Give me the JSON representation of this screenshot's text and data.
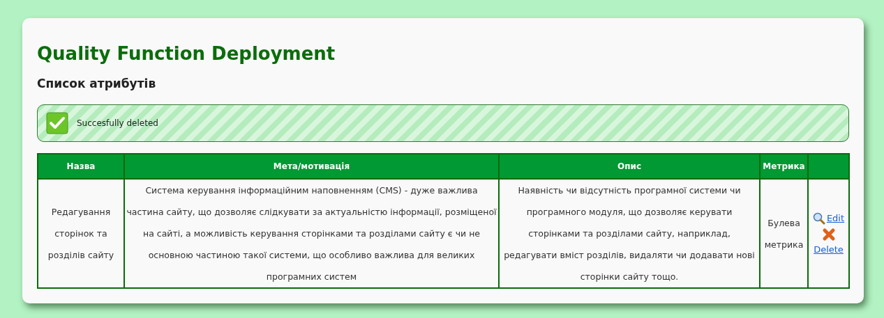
{
  "page": {
    "title": "Quality Function Deployment",
    "subtitle": "Список атрибутів"
  },
  "alert": {
    "kind": "success",
    "message": "Succesfully deleted"
  },
  "table": {
    "columns": [
      "Назва",
      "Мета/мотивація",
      "Опис",
      "Метрика"
    ],
    "rows": [
      {
        "name": "Редагування сторінок та розділів сайту",
        "goal": "Система керування інформаційним наповненням (CMS) - дуже важлива частина сайту, що дозволяє слідкувати за актуальністю інформації, розміщеної на сайті, а можливість керування сторінками та розділами сайту є чи не основною частиною такої системи, що особливо важлива для великих програмних систем",
        "description": "Наявність чи відсутність програмної системи чи програмного модуля, що дозволяє керувати сторінками та розділами сайту, наприклад, редагувати вміст розділів, видаляти чи додавати нові сторінки сайту тощо.",
        "metric": "Булева метрика",
        "actions": [
          "Edit",
          "Delete"
        ]
      }
    ]
  }
}
